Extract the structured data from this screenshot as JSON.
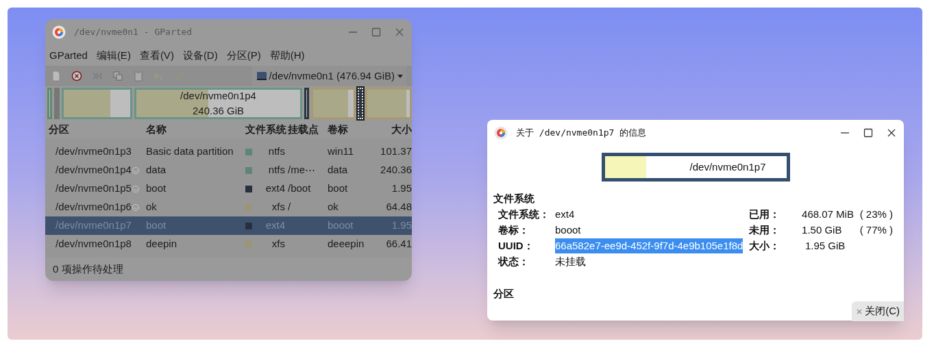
{
  "main_window": {
    "title": "/dev/nvme0n1 - GParted",
    "menu": [
      "GParted",
      "编辑(E)",
      "查看(V)",
      "设备(D)",
      "分区(P)",
      "帮助(H)"
    ],
    "device": "/dev/nvme0n1 (476.94 GiB)",
    "disk_map": [
      {
        "kind": "partition",
        "color": "#5f8a74"
      },
      {
        "kind": "unallocated"
      },
      {
        "kind": "partition",
        "level": 0.7,
        "color": "#6b9488"
      },
      {
        "kind": "partition",
        "level": 0.44,
        "color": "#6b9488",
        "label": "/dev/nvme0n1p4",
        "size": "240.36 GiB"
      },
      {
        "kind": "partition",
        "color": "#2a3342"
      },
      {
        "kind": "partition",
        "level": 0.86,
        "color": "#a89a70"
      },
      {
        "kind": "selected",
        "color": "#2a3342"
      },
      {
        "kind": "partition",
        "level": 0.92,
        "color": "#a89a70"
      }
    ],
    "columns": [
      "分区",
      "名称",
      "文件系统",
      "挂载点",
      "卷标",
      "大小"
    ],
    "rows": [
      {
        "partition": "/dev/nvme0n1p3",
        "flag": false,
        "name": "Basic data partition",
        "color": "#5f8574",
        "filesystem": "ntfs",
        "mount": "",
        "label": "win11",
        "size": "101.37",
        "selected": false
      },
      {
        "partition": "/dev/nvme0n1p4",
        "flag": true,
        "name": "data",
        "color": "#5f8574",
        "filesystem": "ntfs",
        "mount": "/me⋯",
        "label": "data",
        "size": "240.36",
        "selected": false
      },
      {
        "partition": "/dev/nvme0n1p5",
        "flag": true,
        "name": "boot",
        "color": "#283040",
        "filesystem": "ext4",
        "mount": "/boot",
        "label": "boot",
        "size": "1.95",
        "selected": false
      },
      {
        "partition": "/dev/nvme0n1p6",
        "flag": true,
        "name": "ok",
        "color": "#9c9474",
        "filesystem": "xfs",
        "mount": "/",
        "label": "ok",
        "size": "64.48",
        "selected": false
      },
      {
        "partition": "/dev/nvme0n1p7",
        "flag": false,
        "name": "boot",
        "color": "#283040",
        "filesystem": "ext4",
        "mount": "",
        "label": "booot",
        "size": "1.95",
        "selected": true
      },
      {
        "partition": "/dev/nvme0n1p8",
        "flag": false,
        "name": "deepin",
        "color": "#9c9474",
        "filesystem": "xfs",
        "mount": "",
        "label": "deeepin",
        "size": "66.41",
        "selected": false
      }
    ],
    "status_bar": "0 项操作待处理"
  },
  "dialog": {
    "title": "关于 /dev/nvme0n1p7 的信息",
    "partition_bar": {
      "label": "/dev/nvme0n1p7",
      "level": 0.23
    },
    "section_filesystem": "文件系统",
    "fields": [
      {
        "label": "文件系统：",
        "value": "ext4",
        "selected": false
      },
      {
        "label": "卷标：",
        "value": "booot",
        "selected": false
      },
      {
        "label": "UUID：",
        "value": "66a582e7-ee9d-452f-9f7d-4e9b105e1f8d",
        "selected": true
      },
      {
        "label": "状态：",
        "value": "未挂载",
        "selected": false
      }
    ],
    "usage": [
      {
        "label": "已用：",
        "value": "468.07 MiB",
        "percent": "( 23% )"
      },
      {
        "label": "未用：",
        "value": "1.50 GiB",
        "percent": "( 77% )"
      },
      {
        "label": "大小：",
        "value": "1.95 GiB"
      }
    ],
    "section_partition": "分区",
    "close_button": "关闭(C)"
  }
}
